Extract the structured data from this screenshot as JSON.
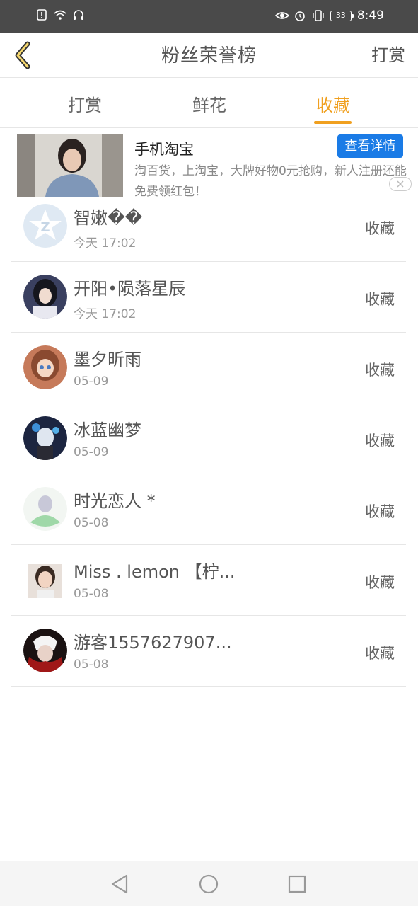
{
  "status_bar": {
    "battery": "33",
    "time": "8:49"
  },
  "header": {
    "title": "粉丝荣誉榜",
    "right_action": "打赏"
  },
  "tabs": [
    {
      "label": "打赏",
      "active": false
    },
    {
      "label": "鲜花",
      "active": false
    },
    {
      "label": "收藏",
      "active": true
    }
  ],
  "ad": {
    "title": "手机淘宝",
    "button": "查看详情",
    "description": "淘百货，上淘宝，大牌好物0元抢购，新人注册还能免费领红包！"
  },
  "fans": [
    {
      "name": "智嫩��",
      "time": "今天 17:02",
      "action": "收藏"
    },
    {
      "name": "开阳•陨落星辰",
      "time": "今天 17:02",
      "action": "收藏"
    },
    {
      "name": "墨夕昕雨",
      "time": "05-09",
      "action": "收藏"
    },
    {
      "name": "冰蓝幽梦",
      "time": "05-09",
      "action": "收藏"
    },
    {
      "name": "时光恋人 *",
      "time": "05-08",
      "action": "收藏"
    },
    {
      "name": "Miss . lemon 【柠...",
      "time": "05-08",
      "action": "收藏"
    },
    {
      "name": "游客1557627907...",
      "time": "05-08",
      "action": "收藏"
    }
  ],
  "colors": {
    "accent": "#f0a020",
    "ad_button": "#1a7be6",
    "status_bar": "#4a4a4a"
  }
}
